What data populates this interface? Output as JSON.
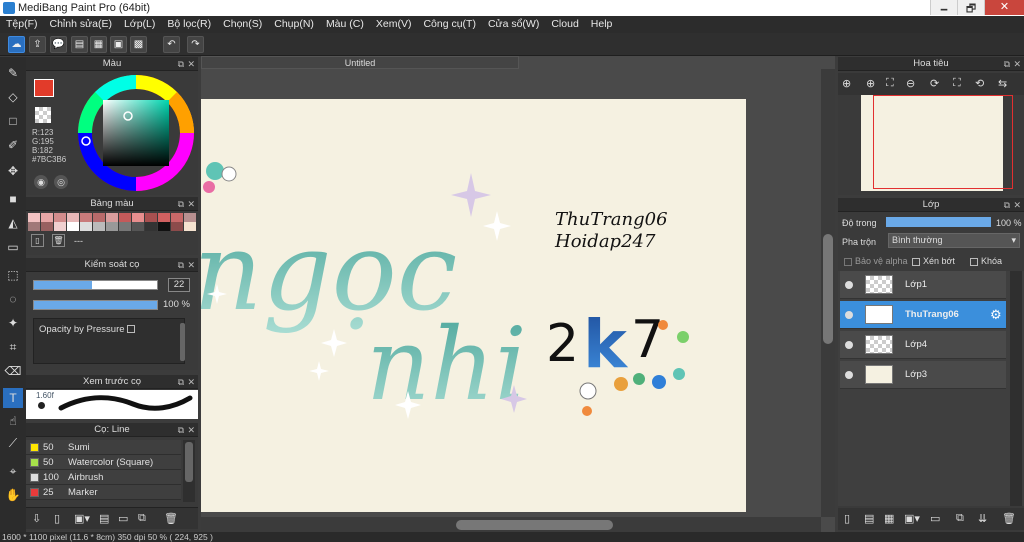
{
  "window": {
    "title": "MediBang Paint Pro (64bit)",
    "minimize": "🗕",
    "maximize": "🗗",
    "close": "✕"
  },
  "menu": [
    "Tệp(F)",
    "Chỉnh sửa(E)",
    "Lớp(L)",
    "Bộ lọc(R)",
    "Chọn(S)",
    "Chụp(N)",
    "Màu (C)",
    "Xem(V)",
    "Công cụ(T)",
    "Cửa sổ(W)",
    "Cloud",
    "Help"
  ],
  "toolbar": {
    "undo": "↶",
    "redo": "↷"
  },
  "color_panel": {
    "title": "Màu",
    "r": "R:123",
    "g": "G:195",
    "b": "B:182",
    "hex": "#7BC3B6",
    "current_color": "#7BC3B6"
  },
  "palette_panel": {
    "title": "Bảng màu",
    "dash": "---",
    "colors": [
      "#f2c2c2",
      "#e8a6a6",
      "#d28c8c",
      "#e7b7b7",
      "#c97b7b",
      "#b86a6a",
      "#d99c9c",
      "#c45a5a",
      "#e88e8e",
      "#a85050",
      "#d06060",
      "#c86868",
      "#b89090",
      "#a07878",
      "#986060",
      "#f0d0d0",
      "#ffffff",
      "#dddddd",
      "#bbbbbb",
      "#999999",
      "#777777",
      "#555555",
      "#333333",
      "#111111",
      "#8c4b4b",
      "#f5e3d0",
      "#e0c0a0"
    ]
  },
  "brush_control": {
    "title": "Kiểm soát cọ",
    "size": "22",
    "opacity": "100 %",
    "size_fraction": 0.47,
    "opacity_fraction": 1.0,
    "pressure_label": "Opacity by Pressure"
  },
  "brush_preview": {
    "title": "Xem trước cọ",
    "size_label": "1.60f"
  },
  "brush_list": {
    "title": "Cọ: Line",
    "items": [
      {
        "size": "50",
        "name": "Sumi",
        "color": "#ffe600"
      },
      {
        "size": "50",
        "name": "Watercolor (Square)",
        "color": "#a6e04a"
      },
      {
        "size": "100",
        "name": "Airbrush",
        "color": "#dddddd"
      },
      {
        "size": "25",
        "name": "Marker",
        "color": "#e83b3b"
      }
    ]
  },
  "document": {
    "tab": "Untitled"
  },
  "artwork": {
    "line1": "ThuTrang06",
    "line2": "Hoidap247",
    "big1": "ngọc",
    "big2": "nhi",
    "k_prefix": "2",
    "k_mid": "k",
    "k_suffix": "7"
  },
  "navigator": {
    "title": "Hoa tiêu"
  },
  "layers_panel": {
    "title": "Lớp",
    "opacity_label": "Độ trong",
    "opacity_value": "100 %",
    "blend_label": "Pha trộn",
    "blend_value": "Bình thường",
    "protect_alpha": "Bảo vệ alpha",
    "clip": "Xén bớt",
    "lock": "Khóa",
    "layers": [
      {
        "name": "Lớp1",
        "selected": false
      },
      {
        "name": "ThuTrang06",
        "selected": true
      },
      {
        "name": "Lớp4",
        "selected": false
      },
      {
        "name": "Lớp3",
        "selected": false
      }
    ]
  },
  "status": {
    "text": "1600 * 1100 pixel   (11.6 * 8cm)   350 dpi   50 %   ( 224, 925 )"
  }
}
